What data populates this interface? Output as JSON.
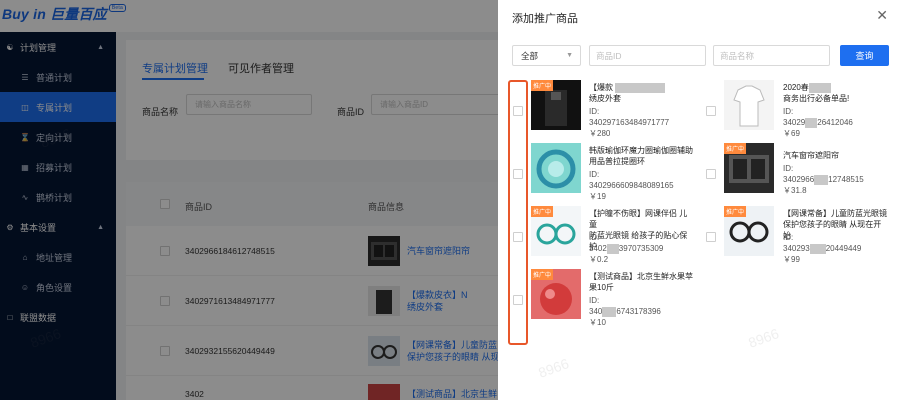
{
  "app": {
    "logo_text": "Buy in 巨量百应",
    "logo_badge": "Beta"
  },
  "sidebar": {
    "groups": [
      {
        "label": "计划管理",
        "items": [
          "普通计划",
          "专属计划",
          "定向计划",
          "招募计划",
          "鹊桥计划"
        ]
      },
      {
        "label": "基本设置",
        "items": [
          "地址管理",
          "角色设置"
        ]
      },
      {
        "label": "联盟数据"
      }
    ]
  },
  "main": {
    "tabs": [
      "专属计划管理",
      "可见作者管理"
    ],
    "filters": [
      {
        "label": "商品名称",
        "placeholder": "请输入商品名称"
      },
      {
        "label": "商品ID",
        "placeholder": "请输入商品ID"
      }
    ],
    "table": {
      "headers": [
        "商品ID",
        "商品信息"
      ],
      "rows": [
        {
          "id": "3402966184612748515",
          "name_line1": "汽车窗帘遮阳帘",
          "name_line2": ""
        },
        {
          "id": "3402971613484971777",
          "name_line1": "【爆款皮衣】N",
          "name_line2": "绣皮外套"
        },
        {
          "id": "3402932155620449449",
          "name_line1": "【网课常备】儿童防蓝",
          "name_line2": "保护您孩子的眼睛 从现"
        },
        {
          "id": "3402",
          "name_line1": "【测试商品】北京生鲜",
          "name_line2": ""
        }
      ]
    }
  },
  "modal": {
    "title": "添加推广商品",
    "select_value": "全部",
    "id_placeholder": "商品ID",
    "name_placeholder": "商品名称",
    "search_button": "查询",
    "promo_tag": "推广中",
    "left_products": [
      {
        "name_line1": "【爆款",
        "name_line2": "绣皮外套",
        "id_label": "ID:",
        "id_prefix": "34029716",
        "id_suffix": "3484971777",
        "price": "￥280"
      },
      {
        "name_line1": "韩版瑜伽环魔力圈瑜伽圈辅助",
        "name_line2": "用品普拉提圈环",
        "id_label": "ID:",
        "id_prefix": "3402966609848089165",
        "id_suffix": "",
        "price": "￥19"
      },
      {
        "name_line1": "【护瞳不伤眼】网课伴侣 儿童",
        "name_line2": "防蓝光眼镜 给孩子的贴心保护",
        "id_label": "ID:",
        "id_prefix": "3402",
        "id_suffix": "3970735309",
        "price": "￥0.2"
      },
      {
        "name_line1": "【测试商品】北京生鲜水果苹",
        "name_line2": "果10斤",
        "id_label": "ID:",
        "id_prefix": "340",
        "id_suffix": "6743178396",
        "price": "￥10"
      }
    ],
    "right_products": [
      {
        "name_line1": "2020春",
        "name_line2": "商务出行必备单品!",
        "id_label": "ID:",
        "id_prefix": "34029",
        "id_suffix": "26412046",
        "price": "￥69"
      },
      {
        "name_line1": "汽车窗帘遮阳帘",
        "name_line2": "",
        "id_label": "ID:",
        "id_prefix": "3402966",
        "id_suffix": "12748515",
        "price": "￥31.8"
      },
      {
        "name_line1": "【网课常备】儿童防蓝光眼镜",
        "name_line2": "保护您孩子的眼睛 从现在开始",
        "id_label": "ID:",
        "id_prefix": "340293",
        "id_suffix": "20449449",
        "price": "￥99"
      }
    ]
  },
  "colors": {
    "primary": "#1e6ff0",
    "sidebar_bg": "#051634",
    "highlight": "#e8572a",
    "promo": "#ff8a3d"
  }
}
